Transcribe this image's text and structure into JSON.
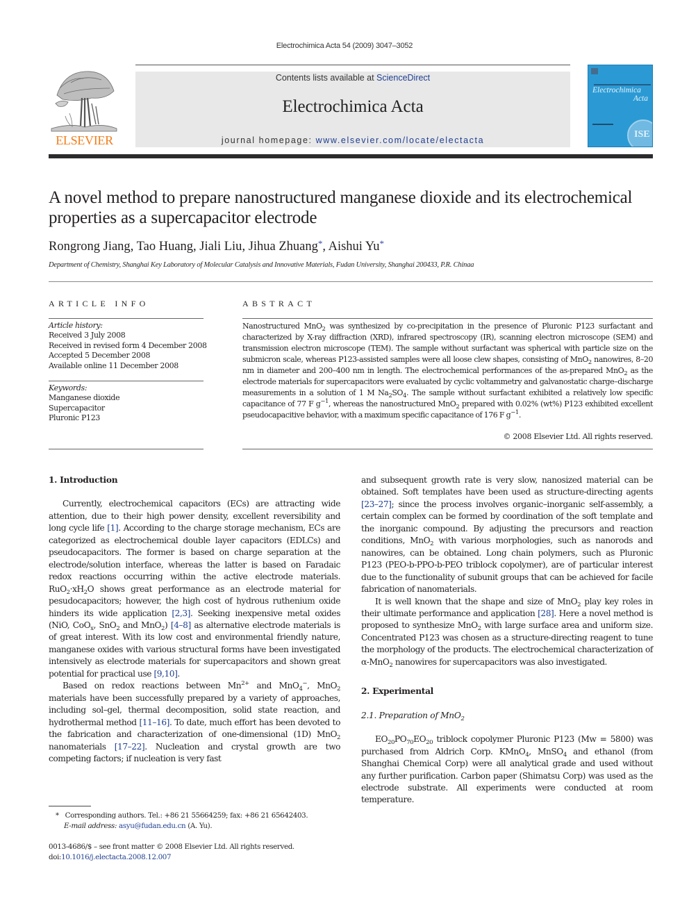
{
  "header": {
    "citation": "Electrochimica Acta 54 (2009) 3047–3052",
    "contents_prefix": "Contents lists available at ",
    "sciencedirect_link": "ScienceDirect",
    "journal_name": "Electrochimica Acta",
    "homepage_prefix": "journal homepage: ",
    "homepage_link": "www.elsevier.com/locate/electacta",
    "publisher_wordmark": "ELSEVIER",
    "cover_title_line1": "Electrochimica",
    "cover_title_line2": "Acta",
    "cover_seal": "ISE",
    "colors": {
      "link": "#1f3f8f",
      "elsevier_orange": "#f07d1a",
      "banner_bg": "#e8e8e9",
      "cover_blue": "#2b9ad4"
    }
  },
  "article": {
    "title": "A novel method to prepare nanostructured manganese dioxide and its electrochemical properties as a supercapacitor electrode",
    "authors": [
      {
        "name": "Rongrong Jiang",
        "corresponding": false
      },
      {
        "name": "Tao Huang",
        "corresponding": false
      },
      {
        "name": "Jiali Liu",
        "corresponding": false
      },
      {
        "name": "Jihua Zhuang",
        "corresponding": true
      },
      {
        "name": "Aishui Yu",
        "corresponding": true
      }
    ],
    "corresponding_mark": "*",
    "affiliation": "Department of Chemistry, Shanghai Key Laboratory of Molecular Catalysis and Innovative Materials, Fudan University, Shanghai 200433, P.R. Chinaa"
  },
  "article_info": {
    "heading": "ARTICLE INFO",
    "history_label": "Article history:",
    "history": [
      "Received 3 July 2008",
      "Received in revised form 4 December 2008",
      "Accepted 5 December 2008",
      "Available online 11 December 2008"
    ],
    "keywords_label": "Keywords:",
    "keywords": [
      "Manganese dioxide",
      "Supercapacitor",
      "Pluronic P123"
    ]
  },
  "abstract": {
    "heading": "ABSTRACT",
    "copyright": "© 2008 Elsevier Ltd. All rights reserved.",
    "t1": "Nanostructured MnO",
    "t2": " was synthesized by co-precipitation in the presence of Pluronic P123 surfactant and characterized by X-ray diffraction (XRD), infrared spectroscopy (IR), scanning electron microscope (SEM) and transmission electron microscope (TEM). The sample without surfactant was spherical with particle size on the submicron scale, whereas P123-assisted samples were all loose clew shapes, consisting of MnO",
    "t3": " nanowires, 8–20 nm in diameter and 200–400 nm in length. The electrochemical performances of the as-prepared MnO",
    "t4": " as the electrode materials for supercapacitors were evaluated by cyclic voltammetry and galvanostatic charge–discharge measurements in a solution of 1 M Na",
    "t5": "SO",
    "t6": ". The sample without surfactant exhibited a relatively low specific capacitance of 77 F g",
    "t7": ", whereas the nanostructured MnO",
    "t8": " prepared with 0.02% (wt%) P123 exhibited excellent pseudocapacitive behavior, with a maximum specific capacitance of 176 F g",
    "t9": ".",
    "sub2": "2",
    "sub4": "4",
    "supneg1": "−1"
  },
  "body": {
    "s1_heading": "1.  Introduction",
    "p1": {
      "a": "Currently, electrochemical capacitors (ECs) are attracting wide attention, due to their high power density, excellent reversibility and long cycle life ",
      "ref1": "[1]",
      "b": ". According to the charge storage mechanism, ECs are categorized as electrochemical double layer capacitors (EDLCs) and pseudocapacitors. The former is based on charge separation at the electrode/solution interface, whereas the latter is based on Faradaic redox reactions occurring within the active electrode materials. RuO",
      "c": "·xH",
      "d": "O shows great performance as an electrode material for pesudocapacitors; however, the high cost of hydrous ruthenium oxide hinders its wide application ",
      "ref2": "[2,3]",
      "e": ". Seeking inexpensive metal oxides (NiO, CoO",
      "subx": "x",
      "f": ", SnO",
      "g": " and MnO",
      "h": ") ",
      "ref3": "[4–8]",
      "i": " as alternative electrode materials is of great interest. With its low cost and environmental friendly nature, manganese oxides with various structural forms have been investigated intensively as electrode materials for supercapacitors and shown great potential for practical use ",
      "ref4": "[9,10]",
      "j": "."
    },
    "p2": {
      "a": "Based on redox reactions between Mn",
      "sup2plus": "2+",
      "b": " and MnO",
      "supminus": "−",
      "c": ", MnO",
      "d": " materials have been successfully prepared by a variety of approaches, including sol–gel, thermal decomposition, solid state reaction, and hydrothermal method ",
      "ref1": "[11–16]",
      "e": ". To date, much effort has been devoted to the fabrication and characterization of one-dimensional (1D) MnO",
      "f": " nanomaterials ",
      "ref2": "[17–22]",
      "g": ". Nucleation and crystal growth are two competing factors; if nucleation is very fast"
    },
    "p3": {
      "a": "and subsequent growth rate is very slow, nanosized material can be obtained. Soft templates have been used as structure-directing agents ",
      "ref1": "[23–27]",
      "b": "; since the process involves organic–inorganic self-assembly, a certain complex can be formed by coordination of the soft template and the inorganic compound. By adjusting the precursors and reaction conditions, MnO",
      "c": " with various morphologies, such as nanorods and nanowires, can be obtained. Long chain polymers, such as Pluronic P123 (PEO-b-PPO-b-PEO triblock copolymer), are of particular interest due to the functionality of subunit groups that can be achieved for facile fabrication of nanomaterials."
    },
    "p4": {
      "a": "It is well known that the shape and size of MnO",
      "b": " play key roles in their ultimate performance and application ",
      "ref1": "[28]",
      "c": ". Here a novel method is proposed to synthesize MnO",
      "d": " with large surface area and uniform size. Concentrated P123 was chosen as a structure-directing reagent to tune the morphology of the products. The electrochemical characterization of α-MnO",
      "e": " nanowires for supercapacitors was also investigated."
    },
    "s2_heading": "2.  Experimental",
    "s21_heading_a": "2.1.  Preparation of MnO",
    "p5": {
      "a": "EO",
      "sub20": "20",
      "b": "PO",
      "sub70": "70",
      "c": "EO",
      "d": " triblock copolymer Pluronic P123 (Mw = 5800) was purchased from Aldrich Corp. KMnO",
      "e": ", MnSO",
      "f": " and ethanol (from Shanghai Chemical Corp) were all analytical grade and used without any further purification. Carbon paper (Shimatsu Corp) was used as the electrode substrate. All experiments were conducted at room temperature."
    }
  },
  "footnotes": {
    "star": "*",
    "corresponding": "Corresponding authors. Tel.: +86 21 55664259; fax: +86 21 65642403.",
    "email_label": "E-mail address:",
    "email": "asyu@fudan.edu.cn",
    "email_suffix": " (A. Yu).",
    "issn": "0013-4686/$ – see front matter © 2008 Elsevier Ltd. All rights reserved.",
    "doi_prefix": "doi:",
    "doi": "10.1016/j.electacta.2008.12.007"
  }
}
